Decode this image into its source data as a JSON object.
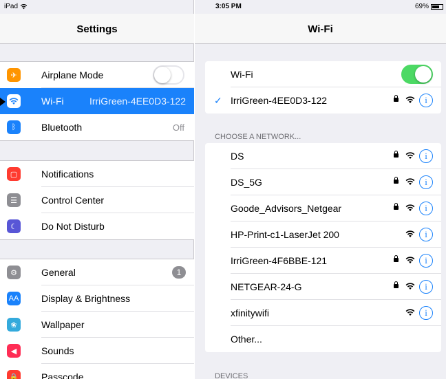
{
  "status_bar": {
    "device": "iPad",
    "time": "3:05 PM",
    "battery": "69%"
  },
  "settings": {
    "title": "Settings",
    "groups": [
      [
        {
          "label": "Airplane Mode",
          "icon": "airplane-icon",
          "color": "#ff9500",
          "glyph": "✈",
          "toggle": false
        },
        {
          "label": "Wi-Fi",
          "icon": "wifi-icon",
          "color": "#1a82fb",
          "glyph": "",
          "value": "IrriGreen-4EE0D3-122",
          "selected": true
        },
        {
          "label": "Bluetooth",
          "icon": "bluetooth-icon",
          "color": "#1a82fb",
          "glyph": "ᛒ",
          "value": "Off"
        }
      ],
      [
        {
          "label": "Notifications",
          "icon": "notifications-icon",
          "color": "#ff3b30",
          "glyph": "▢"
        },
        {
          "label": "Control Center",
          "icon": "control-center-icon",
          "color": "#8e8e93",
          "glyph": "☰"
        },
        {
          "label": "Do Not Disturb",
          "icon": "moon-icon",
          "color": "#5856d6",
          "glyph": "☾"
        }
      ],
      [
        {
          "label": "General",
          "icon": "gear-icon",
          "color": "#8e8e93",
          "glyph": "⚙",
          "badge": "1"
        },
        {
          "label": "Display & Brightness",
          "icon": "display-brightness-icon",
          "color": "#1a82fb",
          "glyph": "AA"
        },
        {
          "label": "Wallpaper",
          "icon": "wallpaper-icon",
          "color": "#34aadc",
          "glyph": "❀"
        },
        {
          "label": "Sounds",
          "icon": "speaker-icon",
          "color": "#ff2d55",
          "glyph": "◀"
        },
        {
          "label": "Passcode",
          "icon": "lock-icon",
          "color": "#ff3b30",
          "glyph": "🔒"
        }
      ]
    ]
  },
  "wifi": {
    "title": "Wi-Fi",
    "toggle_label": "Wi-Fi",
    "enabled": true,
    "connected": {
      "name": "IrriGreen-4EE0D3-122",
      "locked": true
    },
    "choose_label": "CHOOSE A NETWORK...",
    "networks": [
      {
        "name": "DS",
        "locked": true
      },
      {
        "name": "DS_5G",
        "locked": true
      },
      {
        "name": "Goode_Advisors_Netgear",
        "locked": true
      },
      {
        "name": "HP-Print-c1-LaserJet 200",
        "locked": false
      },
      {
        "name": "IrriGreen-4F6BBE-121",
        "locked": true
      },
      {
        "name": "NETGEAR-24-G",
        "locked": true
      },
      {
        "name": "xfinitywifi",
        "locked": false
      }
    ],
    "other_label": "Other...",
    "devices_label": "DEVICES",
    "info_glyph": "i"
  }
}
